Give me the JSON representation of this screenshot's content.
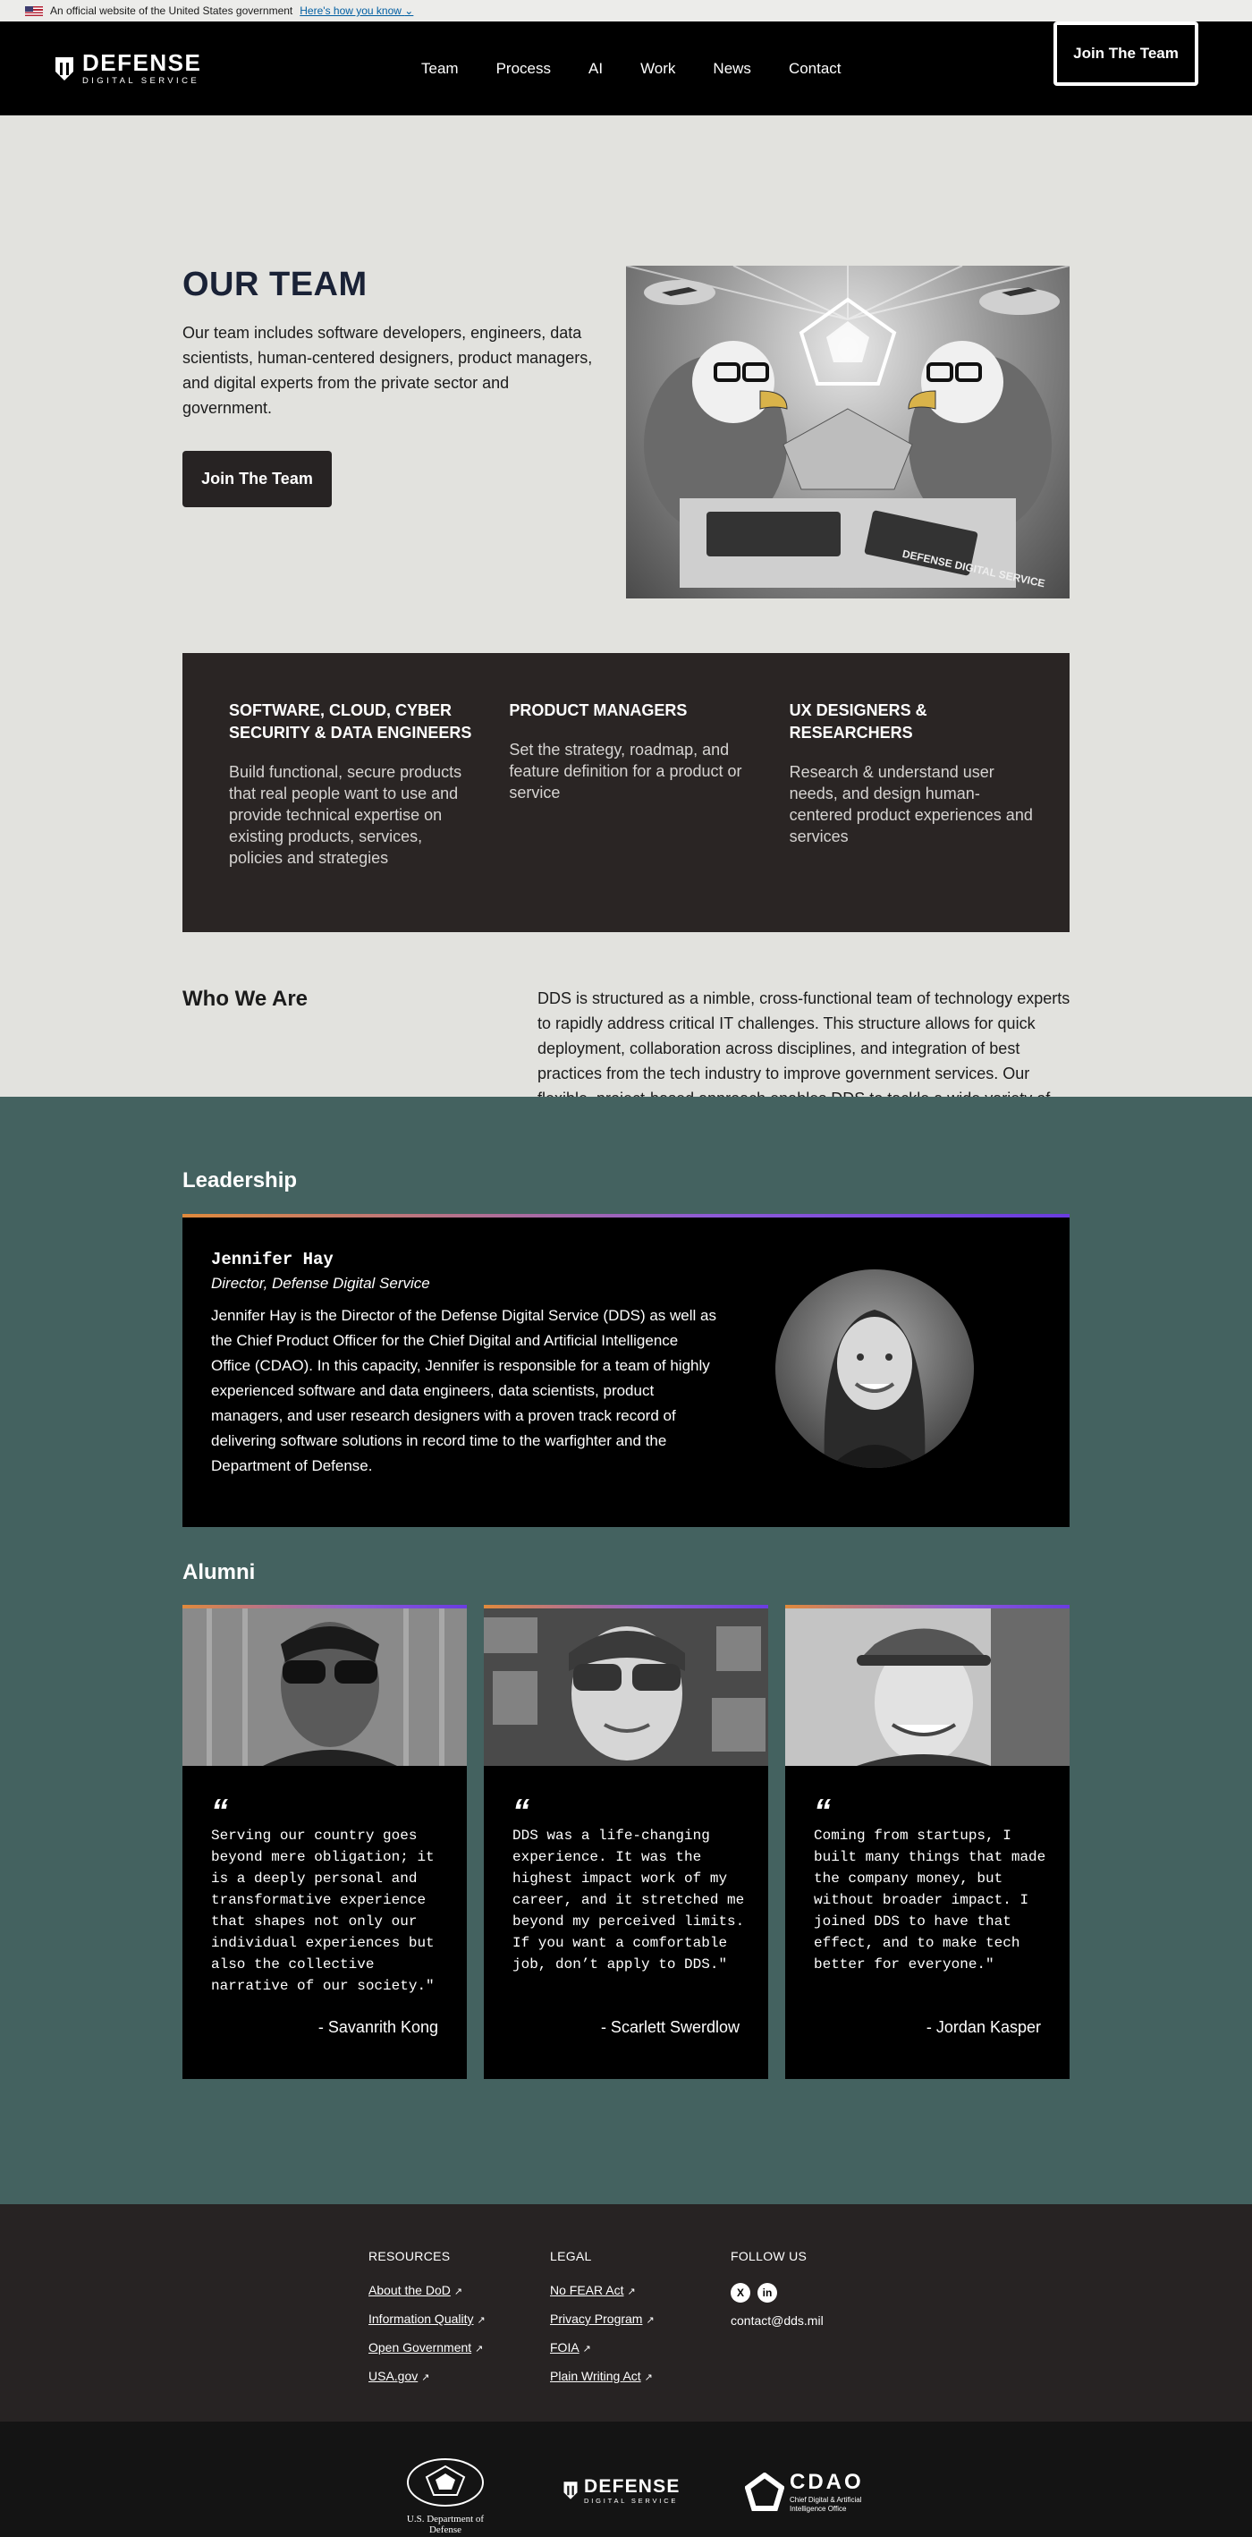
{
  "gov_banner": {
    "text": "An official website of the United States government",
    "link": "Here's how you know"
  },
  "header": {
    "logo_title": "DEFENSE",
    "logo_sub": "DIGITAL SERVICE",
    "nav": [
      "Team",
      "Process",
      "AI",
      "Work",
      "News",
      "Contact"
    ],
    "cta": "Join The Team"
  },
  "team": {
    "title": "OUR TEAM",
    "text": "Our team includes software developers, engineers, data scientists, human-centered designers, product managers, and digital experts from the private sector and government.",
    "button": "Join The Team",
    "hero_sign": "DEFENSE DIGITAL SERVICE"
  },
  "roles": [
    {
      "title": "SOFTWARE, CLOUD, CYBER SECURITY & DATA ENGINEERS",
      "desc": "Build functional, secure products that real people want to use and provide technical expertise on existing products, services, policies and strategies"
    },
    {
      "title": "PRODUCT MANAGERS",
      "desc": "Set the strategy, roadmap, and feature definition for a product or service"
    },
    {
      "title": "UX DESIGNERS & RESEARCHERS",
      "desc": "Research & understand user needs, and design human-centered product experiences and services"
    }
  ],
  "who": {
    "title": "Who We Are",
    "text": "DDS is structured as a nimble, cross-functional team of technology experts to rapidly address critical IT challenges. This structure allows for quick deployment, collaboration across disciplines, and integration of best practices from the tech industry to improve government services. Our flexible, project-based approach enables DDS to tackle a wide variety of high-impact projects efficiently and effectively."
  },
  "leadership": {
    "title": "Leadership",
    "name": "Jennifer Hay",
    "role": "Director, Defense Digital Service",
    "bio": "Jennifer Hay is the Director of the Defense Digital Service (DDS) as well as the Chief Product Officer for the Chief Digital and Artificial Intelligence Office (CDAO). In this capacity, Jennifer is responsible for a team of highly experienced software and data engineers, data scientists, product managers, and user research designers with a proven track record of delivering software solutions in record time to the warfighter and the Department of Defense."
  },
  "alumni": {
    "title": "Alumni",
    "items": [
      {
        "quote": "Serving our country goes beyond mere obligation; it is a deeply personal and transformative experience that shapes not only our individual experiences but also the collective narrative of our society.\"",
        "name": "- Savanrith Kong"
      },
      {
        "quote": "DDS was a life-changing experience. It was the highest impact work of my career, and it stretched me beyond my perceived limits. If you want a comfortable job, don’t apply to DDS.\"",
        "name": "- Scarlett Swerdlow"
      },
      {
        "quote": "Coming from startups, I built many things that made the company money, but without broader impact. I joined DDS to have that effect, and to make tech better for everyone.\"",
        "name": "- Jordan Kasper"
      }
    ]
  },
  "footer": {
    "resources": {
      "title": "RESOURCES",
      "links": [
        "About the DoD",
        "Information Quality",
        "Open Government",
        "USA.gov"
      ]
    },
    "legal": {
      "title": "LEGAL",
      "links": [
        "No FEAR Act",
        "Privacy Program",
        "FOIA",
        "Plain Writing Act"
      ]
    },
    "follow": {
      "title": "FOLLOW US",
      "email": "contact@dds.mil"
    },
    "dod_caption": "U.S. Department of Defense",
    "cdao_title": "CDAO",
    "cdao_sub": "Chief Digital & Artificial Intelligence Office"
  }
}
